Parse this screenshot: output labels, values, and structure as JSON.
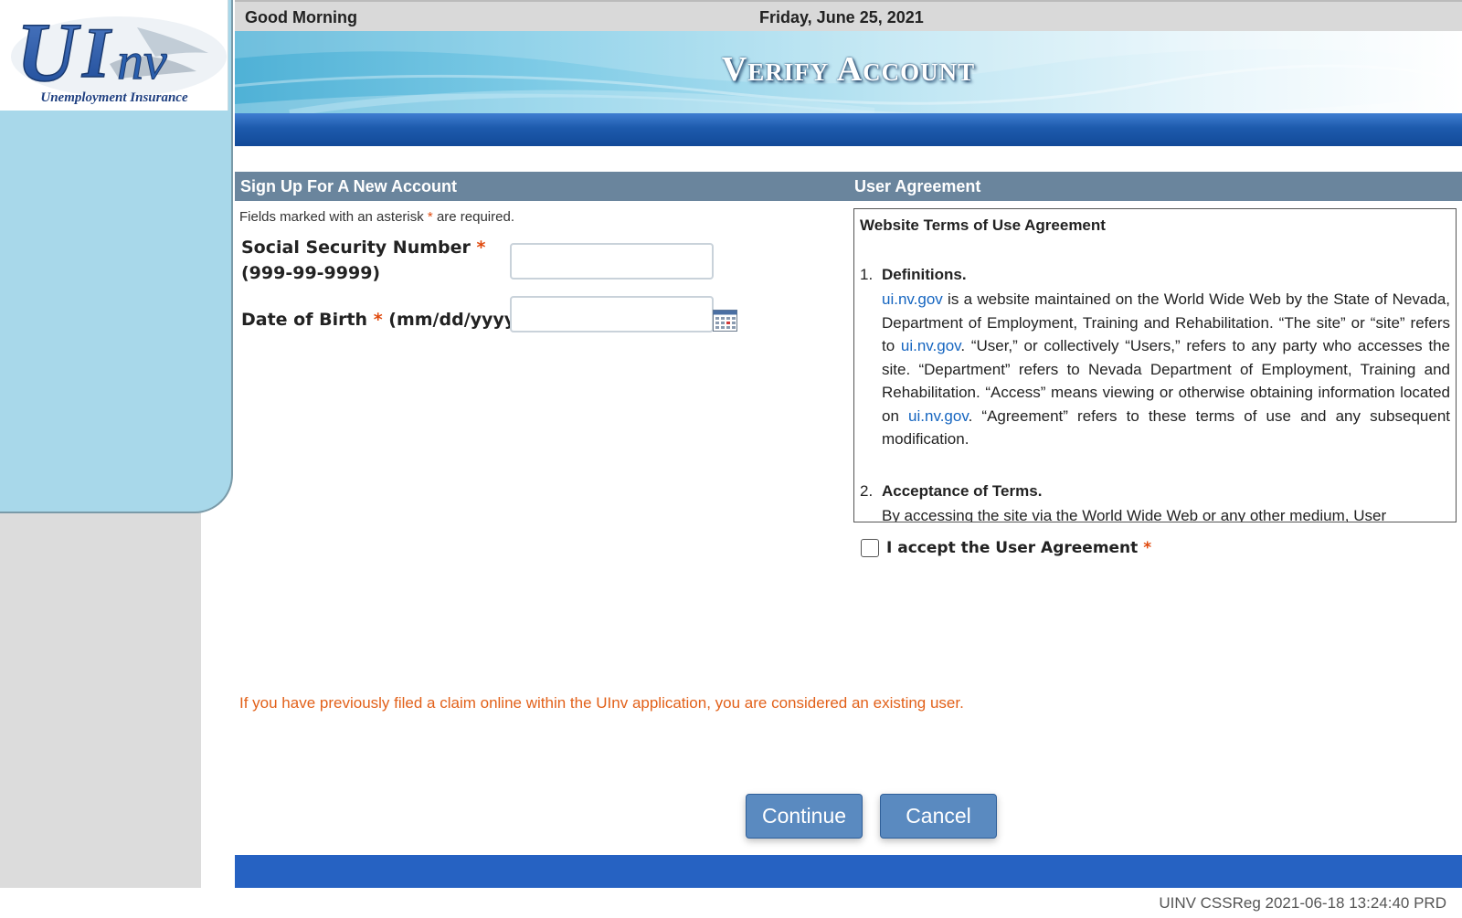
{
  "logo": {
    "mark": "UInv",
    "tagline": "Unemployment Insurance"
  },
  "header": {
    "greeting": "Good Morning",
    "date": "Friday, June 25, 2021",
    "title": "Verify Account"
  },
  "signup": {
    "heading": "Sign Up For A New Account",
    "required_note_before": "Fields marked with an asterisk",
    "required_note_asterisk": "*",
    "required_note_after": "are required.",
    "ssn_label": "Social Security Number",
    "ssn_format": "(999-99-9999)",
    "ssn_value": "",
    "dob_label": "Date of Birth",
    "dob_format": "(mm/dd/yyyy)",
    "dob_value": "",
    "asterisk": "*"
  },
  "agreement": {
    "heading": "User Agreement",
    "box_title": "Website Terms of Use Agreement",
    "terms": [
      {
        "number": "1.",
        "title": "Definitions.",
        "segments": [
          {
            "text": "ui.nv.gov",
            "link": true
          },
          {
            "text": " is a website maintained on the World Wide Web by the State of Nevada, Department of Employment, Training and Rehabilitation. “The site” or “site” refers to ",
            "link": false
          },
          {
            "text": "ui.nv.gov",
            "link": true
          },
          {
            "text": ". “User,” or collectively “Users,” refers to any party who accesses the site. “Department” refers to Nevada Department of Employment, Training and Rehabilitation. “Access” means viewing or otherwise obtaining information located on ",
            "link": false
          },
          {
            "text": "ui.nv.gov",
            "link": true
          },
          {
            "text": ". “Agreement” refers to these terms of use and any subsequent modification.",
            "link": false
          }
        ]
      },
      {
        "number": "2.",
        "title": "Acceptance of Terms.",
        "segments": [
          {
            "text": "By accessing the site via the World Wide Web or any other medium, User",
            "link": false
          }
        ]
      }
    ],
    "accept_label": "I accept the User Agreement",
    "accept_checked": false,
    "asterisk": "*"
  },
  "existing_user_note": "If you have previously filed a claim online within the UInv application, you are considered an existing user.",
  "buttons": {
    "continue": "Continue",
    "cancel": "Cancel"
  },
  "footer": {
    "build_info": "UINV CSSReg 2021-06-18 13:24:40 PRD"
  },
  "colors": {
    "section_header": "#6a859d",
    "nav_bar": "#1d5aac",
    "footer_bar": "#2662c2",
    "sidebar": "#a8d8ea",
    "asterisk": "#e04a0e",
    "notice": "#e2611a",
    "link": "#1565c0",
    "button": "#5a8ac0"
  }
}
